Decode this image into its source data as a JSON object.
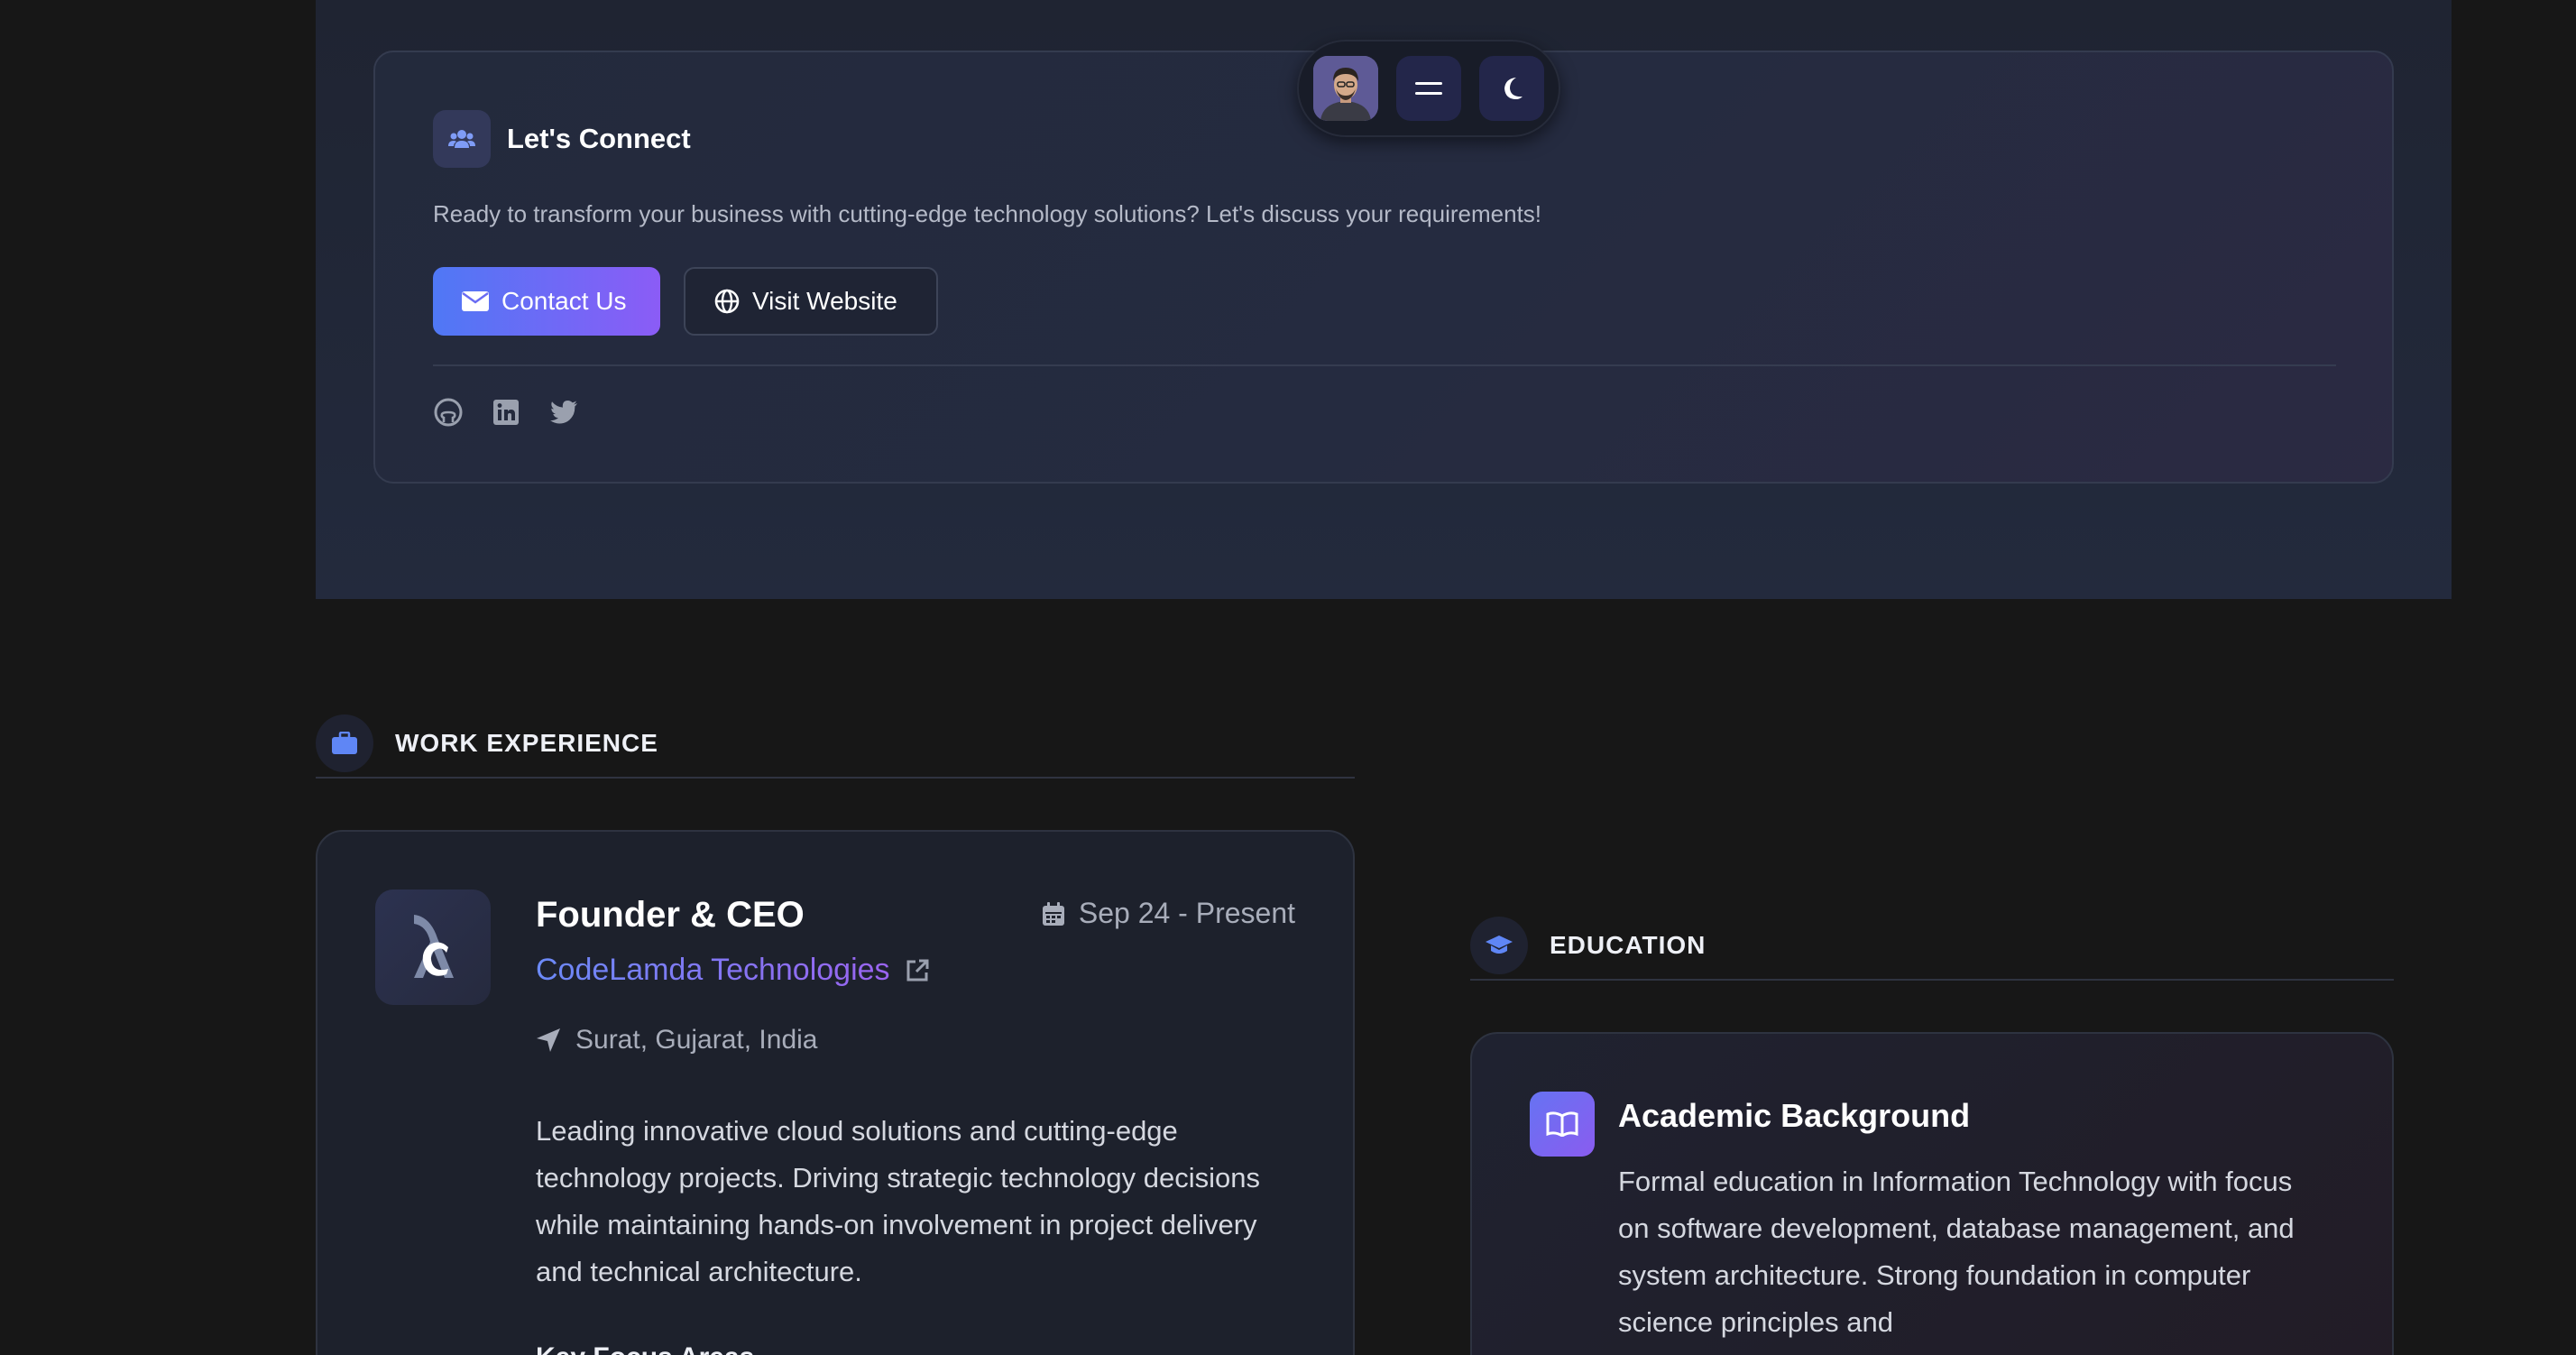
{
  "connect": {
    "title": "Let's Connect",
    "description": "Ready to transform your business with cutting-edge technology solutions? Let's discuss your requirements!",
    "contact_label": "Contact Us",
    "website_label": "Visit Website",
    "socials": [
      "github-icon",
      "linkedin-icon",
      "twitter-icon"
    ]
  },
  "nav": {
    "icons": [
      "avatar",
      "menu-icon",
      "moon-icon"
    ]
  },
  "work": {
    "section_title": "WORK EXPERIENCE",
    "job_title": "Founder & CEO",
    "company": "CodeLamda Technologies",
    "date": "Sep 24 - Present",
    "location": "Surat, Gujarat, India",
    "description": "Leading innovative cloud solutions and cutting-edge technology projects. Driving strategic technology decisions while maintaining hands-on involvement in project delivery and technical architecture.",
    "focus_title": "Key Focus Areas"
  },
  "education": {
    "section_title": "EDUCATION",
    "card_title": "Academic Background",
    "description": "Formal education in Information Technology with focus on software development, database management, and system architecture. Strong foundation in computer science principles and"
  },
  "colors": {
    "accent_blue": "#4f78f5",
    "accent_purple": "#8b5cf6",
    "background": "#171717"
  }
}
